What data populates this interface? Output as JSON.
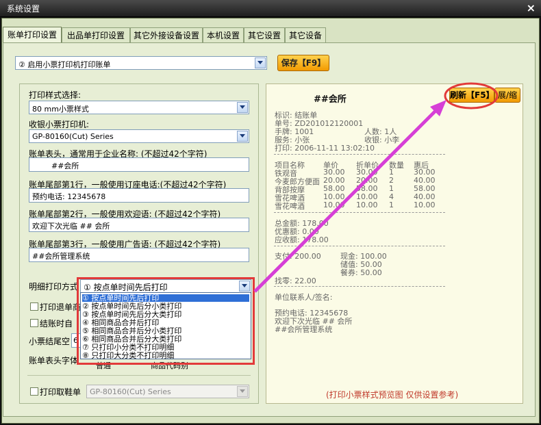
{
  "window": {
    "title": "系统设置",
    "close": "×"
  },
  "tabs": [
    "账单打印设置",
    "出品单打印设置",
    "其它外接设备设置",
    "本机设置",
    "其它设置",
    "其它设备"
  ],
  "top": {
    "print_mode": "② 启用小票打印机打印账单",
    "save_label": "保存【F9】"
  },
  "form": {
    "style_label": "打印样式选择:",
    "style_value": "80  mm小票样式",
    "printer_label": "收银小票打印机:",
    "printer_value": "GP-80160(Cut) Series",
    "header_label": "账单表头，通常用于企业名称:   (不超过42个字符)",
    "header_value": "        ##会所",
    "footer1_label": "账单尾部第1行，一般使用订座电话:(不超过42个字符)",
    "footer1_value": "预约电话: 12345678",
    "footer2_label": "账单尾部第2行，一般使用欢迎语:  (不超过42个字符)",
    "footer2_value": "欢迎下次光临 ## 会所",
    "footer3_label": "账单尾部第3行，一般使用广告语:  (不超过42个字符)",
    "footer3_value": "##会所管理系统",
    "detail_label": "明细打印方式",
    "detail_value": "① 按点单时间先后打印",
    "refund_label": "打印退单商",
    "checkout_label": "结账时自",
    "tail_blank_label": "小票结尾空",
    "tail_blank_value": "6",
    "font_label": "账单表头字体",
    "font_value": "普通",
    "font_value2": "商品代码别",
    "shoe_label": "打印取鞋单",
    "shoe_printer": "GP-80160(Cut) Series"
  },
  "dropdown_options": [
    "① 按点单时间先后打印",
    "② 按点单时间先后分小类打印",
    "③ 按点单时间先后分大类打印",
    "④ 相同商品合并后打印",
    "⑤ 相同商品合并后分小类打印",
    "⑥ 相同商品合并后分大类打印",
    "⑦ 只打印小分类不打印明细",
    "⑧ 只打印大分类不打印明细"
  ],
  "preview": {
    "title": "##会所",
    "refresh_label": "刷新【F5】",
    "expand_label": "展/缩",
    "info": [
      "标识: 结账单",
      "单号: ZD201012120001",
      "手牌: 1001",
      "服务: 小张",
      "打印: 2006-11-11 13:02:10"
    ],
    "people": "人数: 1人",
    "cashier": "收银: 小李",
    "col_headers": [
      "项目名称",
      "单价",
      "折单价",
      "数量",
      "惠后"
    ],
    "items": [
      [
        "铁观音",
        "30.00",
        "30.00",
        "1",
        "30.00"
      ],
      [
        "今麦郎方便面",
        "20.00",
        "20.00",
        "2",
        "40.00"
      ],
      [
        "背部按摩",
        "58.00",
        "58.00",
        "1",
        "58.00"
      ],
      [
        "雪花啤酒",
        "10.00",
        "10.00",
        "4",
        "40.00"
      ],
      [
        "雪花啤酒",
        "10.00",
        "10.00",
        "1",
        "10.00"
      ]
    ],
    "total": "总金额: 178.00",
    "discount": "优惠额: 0.00",
    "receivable": "应收额: 178.00",
    "pay": "支付: 200.00",
    "cash": "现金: 100.00",
    "stored": "储值: 50.00",
    "meal": "餐券: 50.00",
    "change": "找零: 22.00",
    "sign": "单位联系人/签名:",
    "footer1": "预约电话: 12345678",
    "footer2": "欢迎下次光临 ## 会所",
    "footer3": "##会所管理系统",
    "note": "(打印小票样式预览图 仅供设置参考)"
  },
  "colors": {
    "accent_red": "#e23a3a",
    "arrow": "#d63fd6",
    "button": "#f2a400"
  }
}
